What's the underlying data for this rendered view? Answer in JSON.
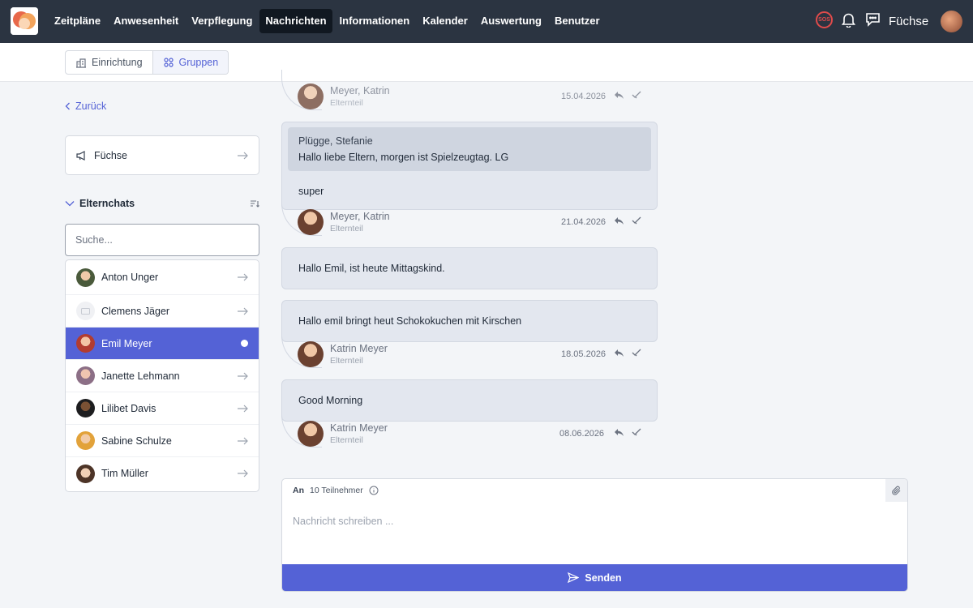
{
  "nav": {
    "items": [
      {
        "label": "Zeitpläne",
        "active": false
      },
      {
        "label": "Anwesenheit",
        "active": false
      },
      {
        "label": "Verpflegung",
        "active": false
      },
      {
        "label": "Nachrichten",
        "active": true
      },
      {
        "label": "Informationen",
        "active": false
      },
      {
        "label": "Kalender",
        "active": false
      },
      {
        "label": "Auswertung",
        "active": false
      },
      {
        "label": "Benutzer",
        "active": false
      }
    ],
    "sos_label": "SOS",
    "group_name": "Füchse"
  },
  "subnav": {
    "setup_label": "Einrichtung",
    "groups_label": "Gruppen"
  },
  "sidebar": {
    "back_label": "Zurück",
    "group_label": "Füchse",
    "section_title": "Elternchats",
    "search_placeholder": "Suche...",
    "chats": [
      {
        "name": "Anton Unger",
        "active": false
      },
      {
        "name": "Clemens Jäger",
        "active": false
      },
      {
        "name": "Emil Meyer",
        "active": true
      },
      {
        "name": "Janette Lehmann",
        "active": false
      },
      {
        "name": "Lilibet Davis",
        "active": false
      },
      {
        "name": "Sabine Schulze",
        "active": false
      },
      {
        "name": "Tim Müller",
        "active": false
      }
    ]
  },
  "messages": [
    {
      "author": "Meyer, Katrin",
      "role": "Elternteil",
      "date": "15.04.2026"
    },
    {
      "quote_author": "Plügge, Stefanie",
      "quote_text": "Hallo liebe Eltern, morgen ist Spielzeugtag. LG",
      "text": "super",
      "author": "Meyer, Katrin",
      "role": "Elternteil",
      "date": "21.04.2026"
    },
    {
      "text": "Hallo Emil, ist heute Mittagskind."
    },
    {
      "text": "Hallo emil bringt heut Schokokuchen mit Kirschen",
      "author": "Katrin Meyer",
      "role": "Elternteil",
      "date": "18.05.2026"
    },
    {
      "text": "Good Morning",
      "author": "Katrin Meyer",
      "role": "Elternteil",
      "date": "08.06.2026"
    }
  ],
  "composer": {
    "to_label": "An",
    "participants": "10 Teilnehmer",
    "placeholder": "Nachricht schreiben ...",
    "send_label": "Senden"
  },
  "colors": {
    "nav_bg": "#2b3441",
    "accent": "#5462d6",
    "bubble": "#e3e7ef",
    "sos": "#e04b4b"
  }
}
